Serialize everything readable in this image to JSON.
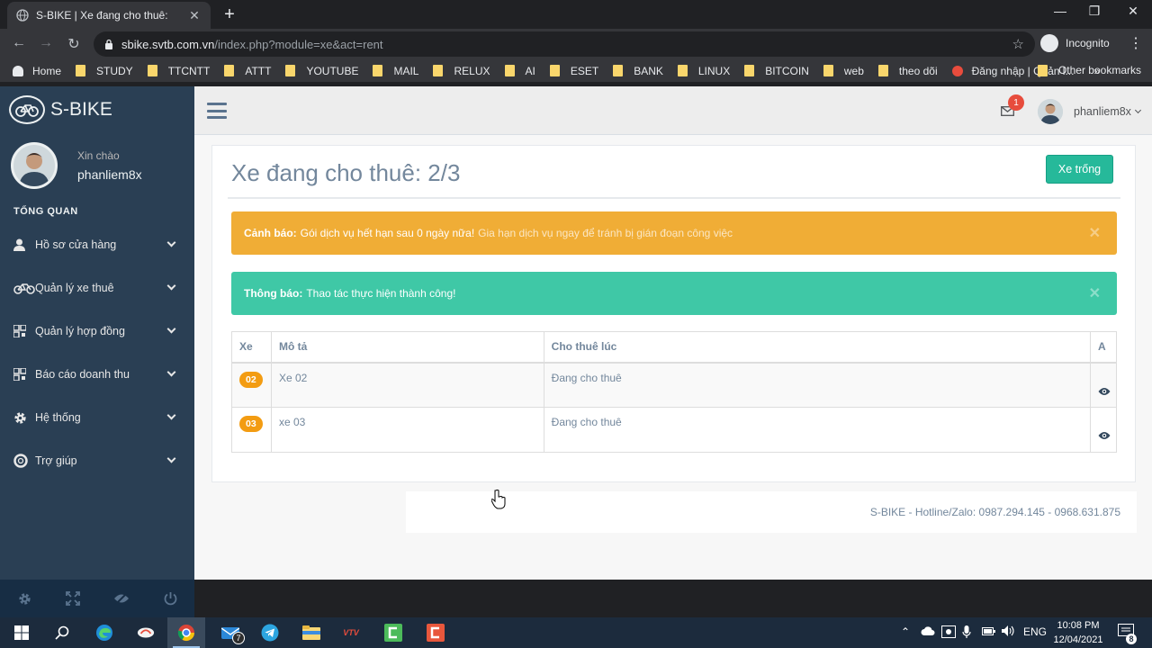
{
  "browser": {
    "tab_title": "S-BIKE | Xe đang cho thuê:",
    "tab_close": "✕",
    "new_tab": "+",
    "url_host": "sbike.svtb.com.vn",
    "url_path": "/index.php?module=xe&act=rent",
    "incognito_label": "Incognito",
    "bookmarks": [
      "Home",
      "STUDY",
      "TTCNTT",
      "ATTT",
      "YOUTUBE",
      "MAIL",
      "RELUX",
      "AI",
      "ESET",
      "BANK",
      "LINUX",
      "BITCOIN",
      "web",
      "theo dõi",
      "Đăng nhập | Quản l..."
    ],
    "bookmarks_more": "»",
    "other_bookmarks": "Other bookmarks"
  },
  "sidebar": {
    "brand": "S-BIKE",
    "greeting": "Xin chào",
    "username": "phanliem8x",
    "section_title": "TỔNG QUAN",
    "menu": [
      {
        "label": "Hồ sơ cửa hàng",
        "icon": "user-icon"
      },
      {
        "label": "Quản lý xe thuê",
        "icon": "bicycle-icon"
      },
      {
        "label": "Quản lý hợp đồng",
        "icon": "qrcode-icon"
      },
      {
        "label": "Báo cáo doanh thu",
        "icon": "qrcode-icon"
      },
      {
        "label": "Hệ thống",
        "icon": "gear-icon"
      },
      {
        "label": "Trợ giúp",
        "icon": "lifebuoy-icon"
      }
    ]
  },
  "topnav": {
    "mail_count": "1",
    "user_name": "phanliem8x"
  },
  "main": {
    "title": "Xe đang cho thuê: 2/3",
    "btn_available": "Xe trống",
    "alert_warning_label": "Cảnh báo:",
    "alert_warning_text": "Gói dịch vụ hết hạn sau 0 ngày nữa!",
    "alert_warning_extra": "Gia hạn dịch vụ ngay để tránh bị gián đoạn công việc",
    "alert_success_label": "Thông báo:",
    "alert_success_text": "Thao tác thực hiện thành công!",
    "alert_close": "✕",
    "table": {
      "headers": [
        "Xe",
        "Mô tả",
        "Cho thuê lúc",
        "A"
      ],
      "rows": [
        {
          "code": "02",
          "desc": "Xe 02",
          "status": "Đang cho thuê"
        },
        {
          "code": "03",
          "desc": "xe 03",
          "status": "Đang cho thuê"
        }
      ]
    }
  },
  "footer": {
    "text": "S-BIKE - Hotline/Zalo: 0987.294.145 - 0968.631.875"
  },
  "taskbar": {
    "mail_badge": "7",
    "lang": "ENG",
    "time": "10:08 PM",
    "date": "12/04/2021",
    "notif_count": "8"
  },
  "colors": {
    "sidebar": "#2a3f54",
    "accent_green": "#26b99a",
    "warning": "#f0ad36",
    "success": "#3fc8a6",
    "badge": "#f39c12"
  }
}
